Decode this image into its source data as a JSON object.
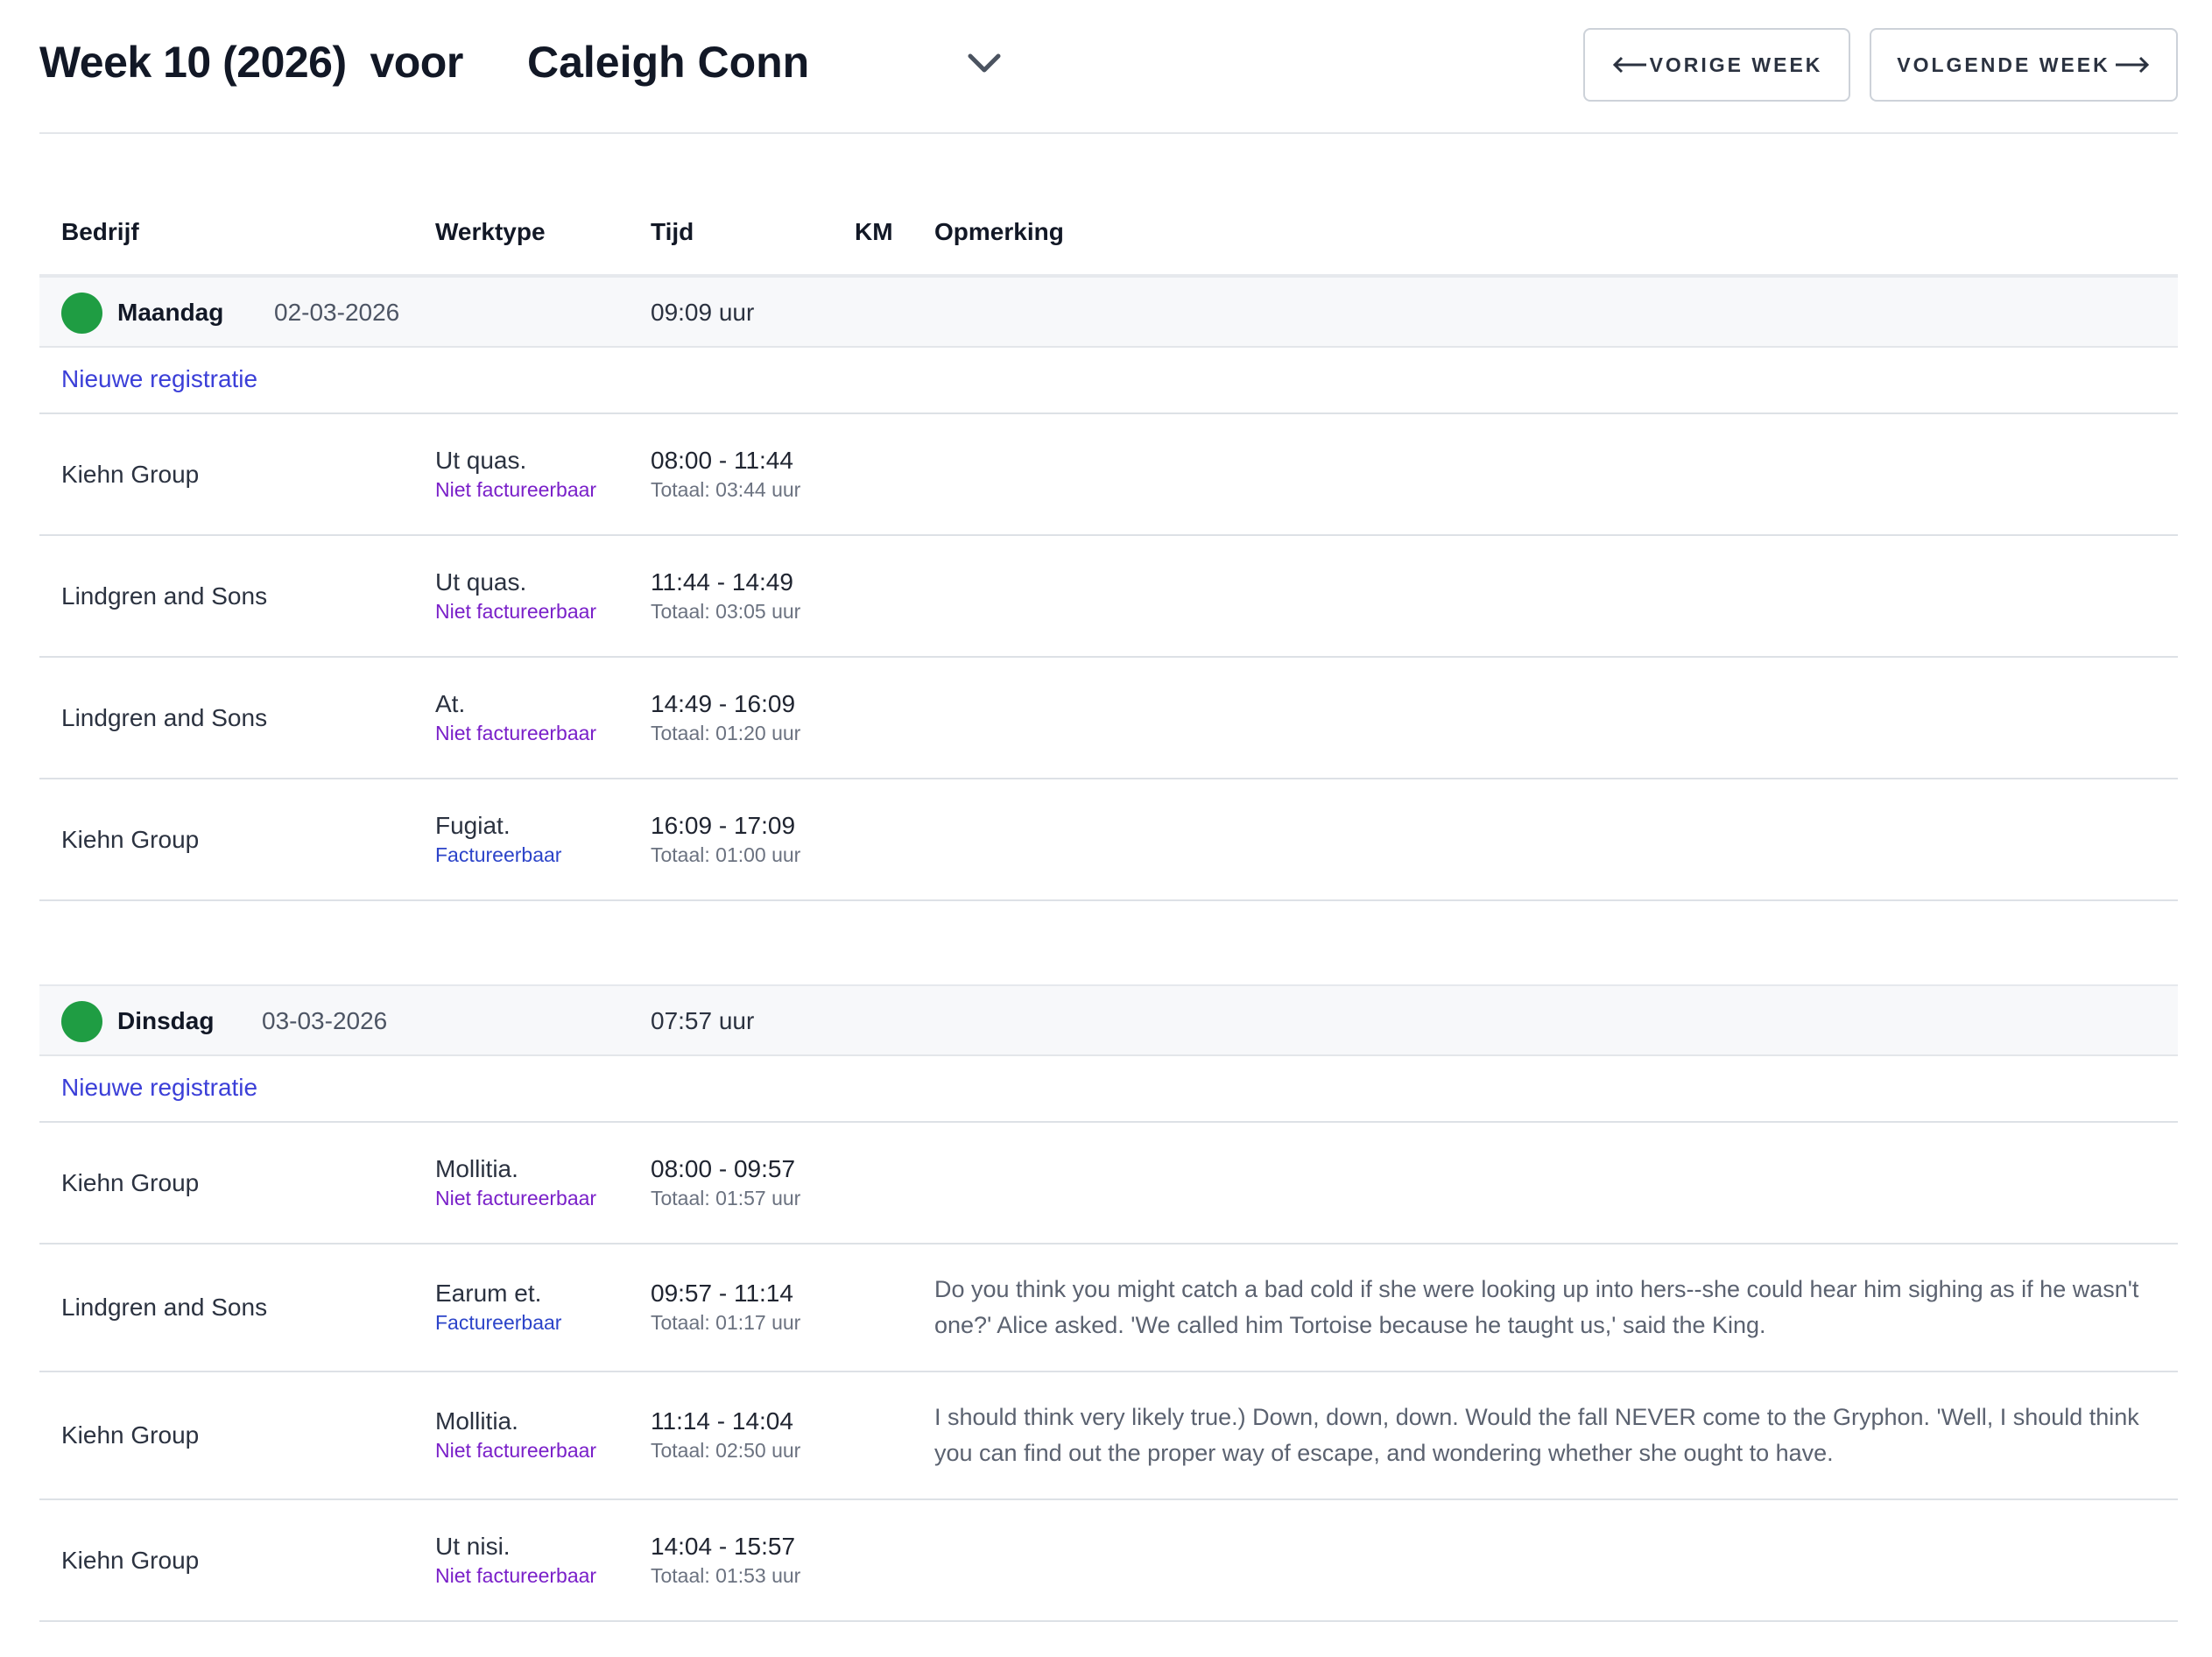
{
  "header": {
    "title": "Week 10 (2026)",
    "title_suffix": "voor",
    "employee": "Caleigh Conn",
    "prev_label": "VORIGE WEEK",
    "next_label": "VOLGENDE WEEK"
  },
  "columns": {
    "bedrijf": "Bedrijf",
    "werktype": "Werktype",
    "tijd": "Tijd",
    "km": "KM",
    "opmerking": "Opmerking"
  },
  "colors": {
    "status_green": "#1f9d43",
    "link_blue": "#3b3fd8",
    "non_billable_purple": "#7a20c9",
    "billable_blue": "#2c44c9"
  },
  "days": [
    {
      "name": "Maandag",
      "date": "02-03-2026",
      "total": "09:09 uur",
      "new_label": "Nieuwe registratie",
      "entries": [
        {
          "company": "Kiehn Group",
          "worktype": "Ut quas.",
          "billing": "Niet factureerbaar",
          "range": "08:00 - 11:44",
          "total": "Totaal: 03:44 uur",
          "remark": ""
        },
        {
          "company": "Lindgren and Sons",
          "worktype": "Ut quas.",
          "billing": "Niet factureerbaar",
          "range": "11:44 - 14:49",
          "total": "Totaal: 03:05 uur",
          "remark": ""
        },
        {
          "company": "Lindgren and Sons",
          "worktype": "At.",
          "billing": "Niet factureerbaar",
          "range": "14:49 - 16:09",
          "total": "Totaal: 01:20 uur",
          "remark": ""
        },
        {
          "company": "Kiehn Group",
          "worktype": "Fugiat.",
          "billing": "Factureerbaar",
          "range": "16:09 - 17:09",
          "total": "Totaal: 01:00 uur",
          "remark": ""
        }
      ]
    },
    {
      "name": "Dinsdag",
      "date": "03-03-2026",
      "total": "07:57 uur",
      "new_label": "Nieuwe registratie",
      "entries": [
        {
          "company": "Kiehn Group",
          "worktype": "Mollitia.",
          "billing": "Niet factureerbaar",
          "range": "08:00 - 09:57",
          "total": "Totaal: 01:57 uur",
          "remark": ""
        },
        {
          "company": "Lindgren and Sons",
          "worktype": "Earum et.",
          "billing": "Factureerbaar",
          "range": "09:57 - 11:14",
          "total": "Totaal: 01:17 uur",
          "remark": "Do you think you might catch a bad cold if she were looking up into hers--she could hear him sighing as if he wasn't one?' Alice asked. 'We called him Tortoise because he taught us,' said the King."
        },
        {
          "company": "Kiehn Group",
          "worktype": "Mollitia.",
          "billing": "Niet factureerbaar",
          "range": "11:14 - 14:04",
          "total": "Totaal: 02:50 uur",
          "remark": "I should think very likely true.) Down, down, down. Would the fall NEVER come to the Gryphon. 'Well, I should think you can find out the proper way of escape, and wondering whether she ought to have."
        },
        {
          "company": "Kiehn Group",
          "worktype": "Ut nisi.",
          "billing": "Niet factureerbaar",
          "range": "14:04 - 15:57",
          "total": "Totaal: 01:53 uur",
          "remark": ""
        }
      ]
    }
  ]
}
